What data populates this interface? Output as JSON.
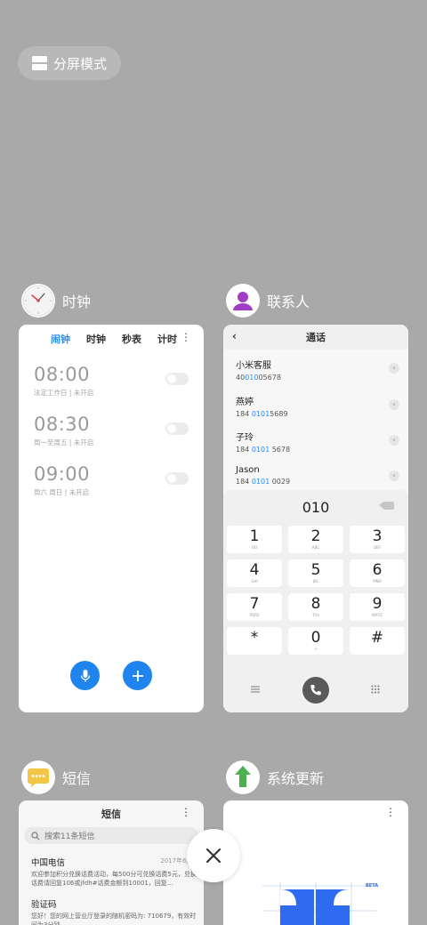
{
  "split_screen": {
    "label": "分屏模式"
  },
  "clock_app": {
    "title": "时钟",
    "tabs": [
      "闹钟",
      "时钟",
      "秒表",
      "计时"
    ],
    "more_icon": "⋮",
    "alarms": [
      {
        "time": "08:00",
        "sub": "法定工作日 | 未开启"
      },
      {
        "time": "08:30",
        "sub": "周一至周五 | 未开启"
      },
      {
        "time": "09:00",
        "sub": "周六 周日 | 未开启"
      }
    ],
    "mic_icon": "mic-icon",
    "add_icon": "plus-icon"
  },
  "contacts_app": {
    "title": "联系人",
    "header": "通话",
    "back_icon": "‹",
    "contacts": [
      {
        "name": "小米客服",
        "num_pre": "40",
        "num_hl": "010",
        "num_post": "05678"
      },
      {
        "name": "燕婷",
        "num_pre": "184 ",
        "num_hl": "0101",
        "num_post": "5689"
      },
      {
        "name": "子玲",
        "num_pre": "184 ",
        "num_hl": "0101",
        "num_post": " 5678"
      },
      {
        "name": "Jason",
        "num_pre": "184 ",
        "num_hl": "0101",
        "num_post": " 0029"
      }
    ],
    "arrow": "›",
    "dial_display": "010",
    "keys": [
      {
        "n": "1",
        "s": "OO"
      },
      {
        "n": "2",
        "s": "ABC"
      },
      {
        "n": "3",
        "s": "DEF"
      },
      {
        "n": "4",
        "s": "GHI"
      },
      {
        "n": "5",
        "s": "JKL"
      },
      {
        "n": "6",
        "s": "MNO"
      },
      {
        "n": "7",
        "s": "PQRS"
      },
      {
        "n": "8",
        "s": "TUV"
      },
      {
        "n": "9",
        "s": "WXYZ"
      },
      {
        "n": "*",
        "s": ""
      },
      {
        "n": "0",
        "s": "+"
      },
      {
        "n": "#",
        "s": ""
      }
    ]
  },
  "sms_app": {
    "title": "短信",
    "header": "短信",
    "more_icon": "⋮",
    "search_placeholder": "搜索11条短信",
    "messages": [
      {
        "sender": "中国电信",
        "date": "2017年6月3",
        "body": "欢迎参加积分兑换话费活动，每500分可兑换话费5元，兑换话费请回复106或jfdh#话费金额到10001，回复..."
      },
      {
        "sender": "验证码",
        "date": "",
        "body": "您好！您的网上营业厅登录的随机密码为: 710679，有效时间为3分钟"
      }
    ]
  },
  "update_app": {
    "title": "系统更新",
    "more_icon": "⋮",
    "beta_label": "BETA"
  },
  "close": {
    "icon": "close-icon"
  },
  "colors": {
    "accent": "#2e8ff0",
    "fab": "#1f84ee",
    "background": "#a9a9a9"
  }
}
